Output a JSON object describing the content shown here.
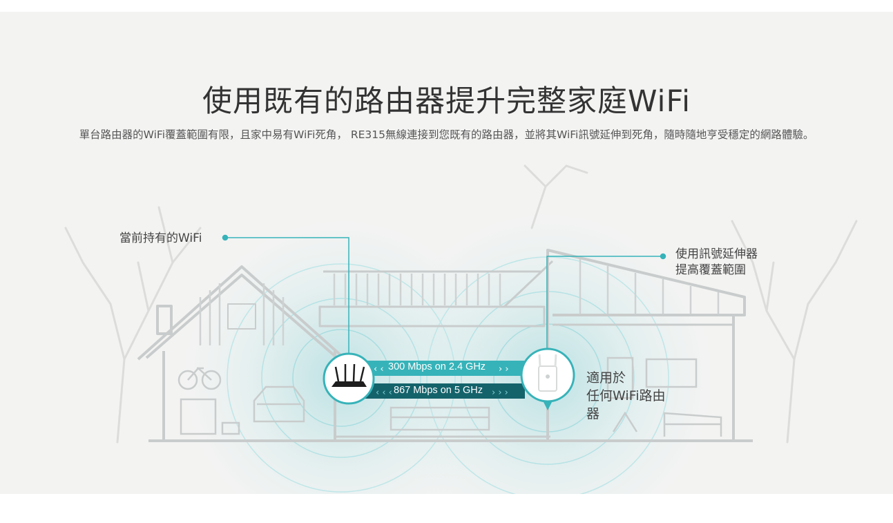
{
  "heading": "使用既有的路由器提升完整家庭WiFi",
  "description": "單台路由器的WiFi覆蓋範圍有限，且家中易有WiFi死角， RE315無線連接到您既有的路由器，並將其WiFi訊號延伸到死角，隨時隨地亨受穩定的網路體驗。",
  "callouts": {
    "current_wifi": "當前持有的WiFi",
    "extender_line1": "使用訊號延伸器",
    "extender_line2": "提高覆蓋範圍",
    "fit_line1": "適用於",
    "fit_line2": "任何WiFi路由",
    "fit_line3": "器"
  },
  "links": {
    "band_24": "300 Mbps on 2.4 GHz",
    "band_5": "867 Mbps on 5 GHz"
  },
  "colors": {
    "accent": "#36b3b9",
    "accent_dark": "#14636b",
    "band_bg": "#f3f3f2",
    "house_line": "#c9cccc"
  },
  "icons": [
    "router-icon",
    "range-extender-icon",
    "bicycle-icon",
    "car-icon",
    "sofa-icon",
    "bed-icon",
    "tree-icon"
  ]
}
